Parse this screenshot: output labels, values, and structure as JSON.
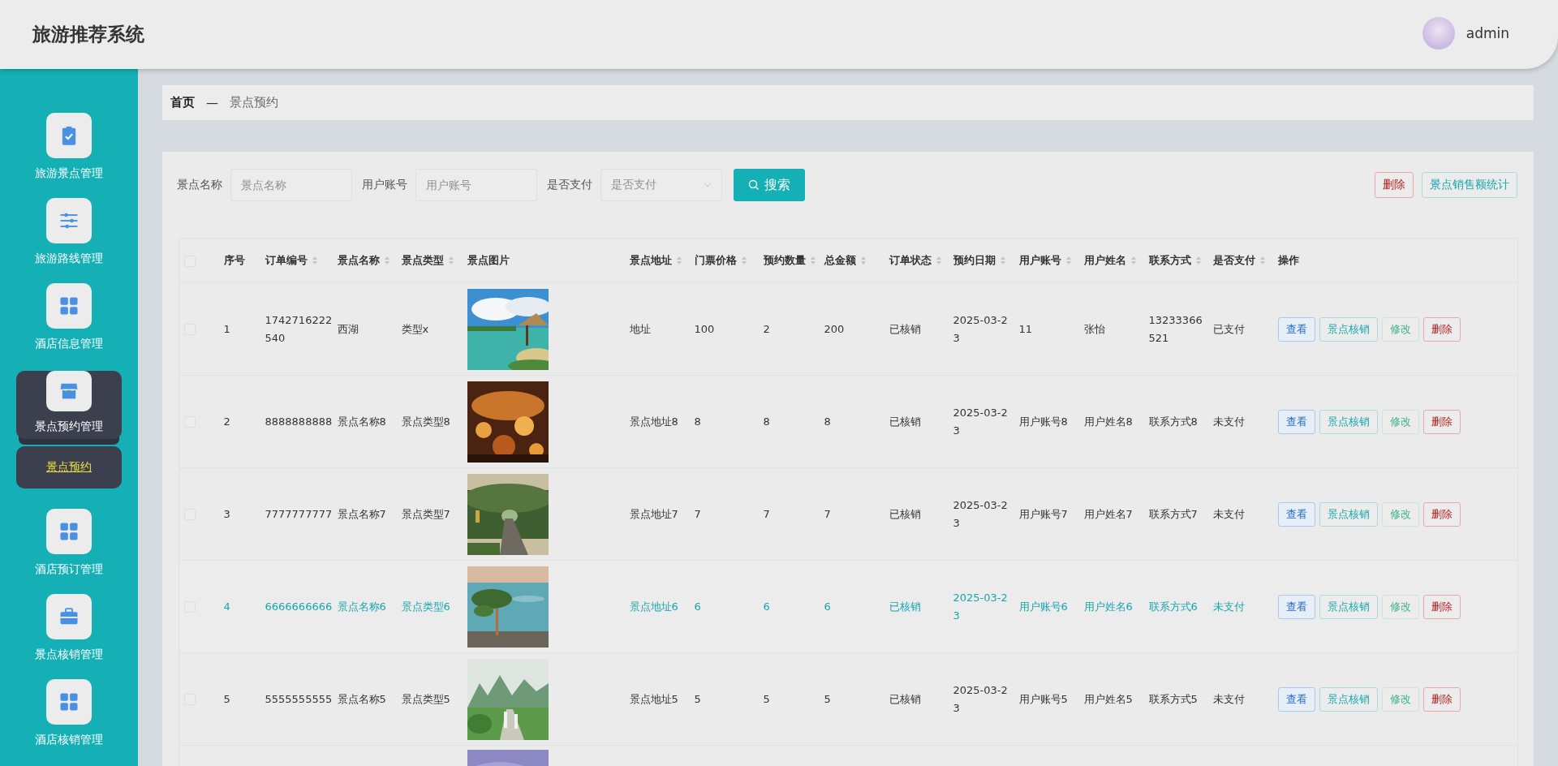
{
  "header": {
    "title": "旅游推荐系统",
    "user": "admin"
  },
  "sidebar": {
    "items": [
      {
        "label": "旅游景点管理",
        "selected": false
      },
      {
        "label": "旅游路线管理",
        "selected": false
      },
      {
        "label": "酒店信息管理",
        "selected": false
      },
      {
        "label": "景点预约管理",
        "selected": true,
        "expanded": true,
        "children": [
          {
            "label": "景点预约",
            "selected": true
          }
        ]
      },
      {
        "label": "酒店预订管理",
        "selected": false
      },
      {
        "label": "景点核销管理",
        "selected": false
      },
      {
        "label": "酒店核销管理",
        "selected": false
      }
    ]
  },
  "breadcrumb": {
    "items": [
      "首页",
      "景点预约"
    ],
    "separator": "—"
  },
  "search": {
    "fields": [
      {
        "label": "景点名称",
        "placeholder": "景点名称",
        "kind": "text"
      },
      {
        "label": "用户账号",
        "placeholder": "用户账号",
        "kind": "text"
      },
      {
        "label": "是否支付",
        "placeholder": "是否支付",
        "kind": "select"
      }
    ],
    "button": "搜索"
  },
  "toolbar_buttons": [
    {
      "label": "删除",
      "kind": "danger"
    },
    {
      "label": "景点销售额统计",
      "kind": "stat"
    }
  ],
  "table": {
    "select_all": {
      "checked": false
    },
    "columns": [
      {
        "label": "序号",
        "kind": "text",
        "sortable": false
      },
      {
        "label": "订单编号",
        "kind": "text",
        "sortable": true
      },
      {
        "label": "景点名称",
        "kind": "text",
        "sortable": true
      },
      {
        "label": "景点类型",
        "kind": "text",
        "sortable": true
      },
      {
        "label": "景点图片",
        "kind": "picture",
        "sortable": false
      },
      {
        "label": "景点地址",
        "kind": "text",
        "sortable": true
      },
      {
        "label": "门票价格",
        "kind": "text",
        "sortable": true
      },
      {
        "label": "预约数量",
        "kind": "text",
        "sortable": true
      },
      {
        "label": "总金额",
        "kind": "text",
        "sortable": true
      },
      {
        "label": "订单状态",
        "kind": "text",
        "sortable": true
      },
      {
        "label": "预约日期",
        "kind": "text",
        "sortable": true
      },
      {
        "label": "用户账号",
        "kind": "text",
        "sortable": true
      },
      {
        "label": "用户姓名",
        "kind": "text",
        "sortable": true
      },
      {
        "label": "联系方式",
        "kind": "text",
        "sortable": true
      },
      {
        "label": "是否支付",
        "kind": "text",
        "sortable": true
      },
      {
        "label": "操作",
        "kind": "actions",
        "sortable": false
      }
    ],
    "rows": [
      {
        "checked": false,
        "hovered": false,
        "cells": [
          "1",
          "1742716222540",
          "西湖",
          "类型x",
          "",
          "地址",
          "100",
          "2",
          "200",
          "已核销",
          "2025-03-23",
          "11",
          "张怡",
          "13233366521",
          "已支付"
        ],
        "actions": [
          {
            "label": "查看",
            "kind": "view"
          },
          {
            "label": "景点核销",
            "kind": "verify"
          },
          {
            "label": "修改",
            "kind": "edit"
          },
          {
            "label": "删除",
            "kind": "danger"
          }
        ]
      },
      {
        "checked": false,
        "hovered": false,
        "cells": [
          "2",
          "8888888888",
          "景点名称8",
          "景点类型8",
          "",
          "景点地址8",
          "8",
          "8",
          "8",
          "已核销",
          "2025-03-23",
          "用户账号8",
          "用户姓名8",
          "联系方式8",
          "未支付"
        ],
        "actions": [
          {
            "label": "查看",
            "kind": "view"
          },
          {
            "label": "景点核销",
            "kind": "verify"
          },
          {
            "label": "修改",
            "kind": "edit"
          },
          {
            "label": "删除",
            "kind": "danger"
          }
        ]
      },
      {
        "checked": false,
        "hovered": false,
        "cells": [
          "3",
          "7777777777",
          "景点名称7",
          "景点类型7",
          "",
          "景点地址7",
          "7",
          "7",
          "7",
          "已核销",
          "2025-03-23",
          "用户账号7",
          "用户姓名7",
          "联系方式7",
          "未支付"
        ],
        "actions": [
          {
            "label": "查看",
            "kind": "view"
          },
          {
            "label": "景点核销",
            "kind": "verify"
          },
          {
            "label": "修改",
            "kind": "edit"
          },
          {
            "label": "删除",
            "kind": "danger"
          }
        ]
      },
      {
        "checked": false,
        "hovered": true,
        "cells": [
          "4",
          "6666666666",
          "景点名称6",
          "景点类型6",
          "",
          "景点地址6",
          "6",
          "6",
          "6",
          "已核销",
          "2025-03-23",
          "用户账号6",
          "用户姓名6",
          "联系方式6",
          "未支付"
        ],
        "actions": [
          {
            "label": "查看",
            "kind": "view"
          },
          {
            "label": "景点核销",
            "kind": "verify"
          },
          {
            "label": "修改",
            "kind": "edit"
          },
          {
            "label": "删除",
            "kind": "danger"
          }
        ]
      },
      {
        "checked": false,
        "hovered": false,
        "cells": [
          "5",
          "5555555555",
          "景点名称5",
          "景点类型5",
          "",
          "景点地址5",
          "5",
          "5",
          "5",
          "已核销",
          "2025-03-23",
          "用户账号5",
          "用户姓名5",
          "联系方式5",
          "未支付"
        ],
        "actions": [
          {
            "label": "查看",
            "kind": "view"
          },
          {
            "label": "景点核销",
            "kind": "verify"
          },
          {
            "label": "修改",
            "kind": "edit"
          },
          {
            "label": "删除",
            "kind": "danger"
          }
        ]
      }
    ]
  }
}
